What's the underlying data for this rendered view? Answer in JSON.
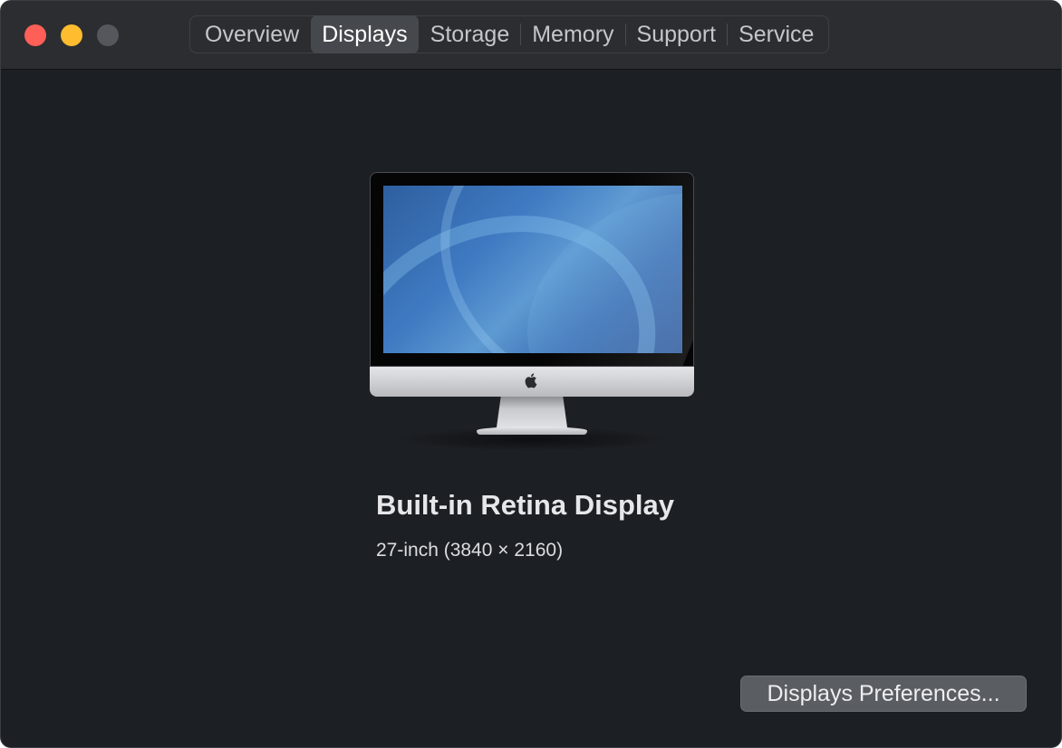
{
  "window": {
    "controls": {
      "close_color": "#fe5f57",
      "minimize_color": "#febc2e",
      "zoom_color": "#55575c"
    }
  },
  "tabs": [
    {
      "label": "Overview",
      "active": false
    },
    {
      "label": "Displays",
      "active": true
    },
    {
      "label": "Storage",
      "active": false
    },
    {
      "label": "Memory",
      "active": false
    },
    {
      "label": "Support",
      "active": false
    },
    {
      "label": "Service",
      "active": false
    }
  ],
  "display": {
    "icon": "imac-icon",
    "name": "Built-in Retina Display",
    "spec": "27-inch (3840 × 2160)"
  },
  "actions": {
    "preferences_label": "Displays Preferences..."
  }
}
